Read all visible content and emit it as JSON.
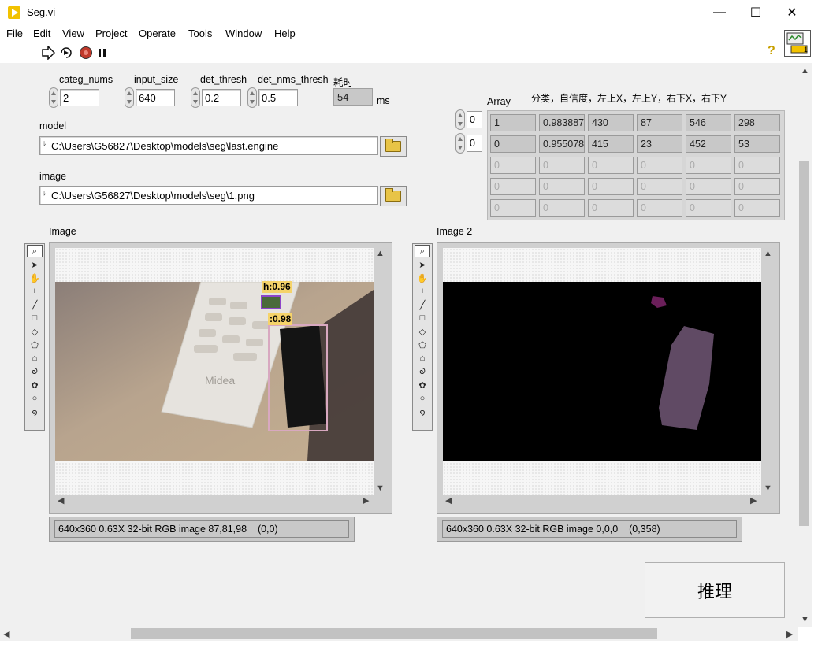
{
  "window": {
    "title": "Seg.vi",
    "controls": {
      "minimize": "—",
      "maximize": "☐",
      "close": "✕"
    }
  },
  "menu": [
    "File",
    "Edit",
    "View",
    "Project",
    "Operate",
    "Tools",
    "Window",
    "Help"
  ],
  "vi_icon_number": "1",
  "controls": {
    "categ_nums": {
      "label": "categ_nums",
      "value": "2"
    },
    "input_size": {
      "label": "input_size",
      "value": "640"
    },
    "det_thresh": {
      "label": "det_thresh",
      "value": "0.2"
    },
    "det_nms_thresh": {
      "label": "det_nms_thresh",
      "value": "0.5"
    },
    "elapsed": {
      "label": "耗时",
      "value": "54",
      "unit": "ms"
    },
    "model": {
      "label": "model",
      "path": "C:\\Users\\G56827\\Desktop\\models\\seg\\last.engine"
    },
    "image": {
      "label": "image",
      "path": "C:\\Users\\G56827\\Desktop\\models\\seg\\1.png"
    }
  },
  "array": {
    "label": "Array",
    "header": "分类，自信度，左上X，左上Y，右下X，右下Y",
    "row_index": "0",
    "col_index": "0",
    "rows": [
      [
        "1",
        "0.983887",
        "430",
        "87",
        "546",
        "298"
      ],
      [
        "0",
        "0.955078",
        "415",
        "23",
        "452",
        "53"
      ],
      [
        "0",
        "0",
        "0",
        "0",
        "0",
        "0"
      ],
      [
        "0",
        "0",
        "0",
        "0",
        "0",
        "0"
      ],
      [
        "0",
        "0",
        "0",
        "0",
        "0",
        "0"
      ]
    ]
  },
  "image1": {
    "label": "Image",
    "status": "640x360 0.63X 32-bit RGB image 87,81,98    (0,0)",
    "detections": [
      {
        "text": "h:0.96",
        "color": "#8e44c9"
      },
      {
        "text": ":0.98",
        "color": "#d8a8c0"
      }
    ]
  },
  "image2": {
    "label": "Image 2",
    "status": "640x360 0.63X 32-bit RGB image 0,0,0    (0,358)"
  },
  "tool_icons": [
    "zoom-icon",
    "pointer-icon",
    "pan-icon",
    "crosshair-icon",
    "line-icon",
    "rectangle-icon",
    "rotated-rect-icon",
    "oval-icon",
    "polygon-icon",
    "freehand-icon",
    "annulus-icon",
    "circle-icon",
    "broken-line-icon"
  ],
  "infer_button": "推理",
  "colors": {
    "panel_bg": "#f0f0f0",
    "accent_yellow": "#f2c200",
    "run_red": "#c0392b"
  }
}
